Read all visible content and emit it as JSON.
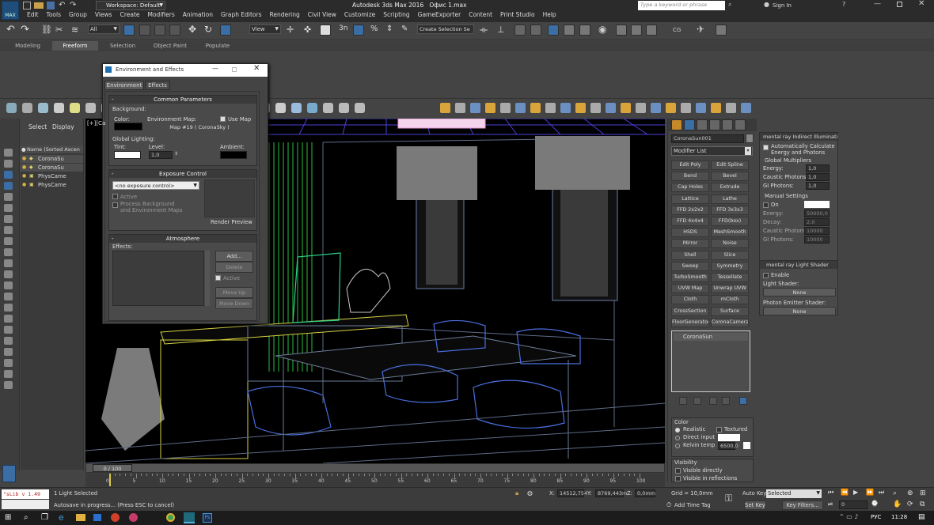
{
  "window": {
    "title": "Autodesk 3ds Max 2016",
    "file": "Офис 1.max",
    "workspace": "Workspace: Default",
    "search_placeholder": "Type a keyword or phrase",
    "sign_in": "Sign In",
    "logo": "MAX"
  },
  "menu": [
    "Edit",
    "Tools",
    "Group",
    "Views",
    "Create",
    "Modifiers",
    "Animation",
    "Graph Editors",
    "Rendering",
    "Civil View",
    "Customize",
    "Scripting",
    "GameExporter",
    "Content",
    "Print Studio",
    "Help"
  ],
  "toolbar": {
    "filter": "All",
    "refcoord": "View",
    "selection_set": "Create Selection Se",
    "snap_label": "3"
  },
  "ribbon_tabs": [
    "Modeling",
    "Freeform",
    "Selection",
    "Object Paint",
    "Populate"
  ],
  "scene_explorer": {
    "tabs": [
      "Select",
      "Display"
    ],
    "header": "Name (Sorted Ascen",
    "items": [
      "CoronaSu",
      "CoronaSu",
      "PhysCame",
      "PhysCame"
    ]
  },
  "viewport": {
    "label": "[+][Ca"
  },
  "dialog": {
    "title": "Environment and Effects",
    "tabs": [
      "Environment",
      "Effects"
    ],
    "common": {
      "header": "Common Parameters",
      "background": "Background:",
      "color": "Color:",
      "envmap": "Environment Map:",
      "use_map": "Use Map",
      "map_name": "Map #19  ( CoronaSky )",
      "global_lighting": "Global Lighting:",
      "tint": "Tint:",
      "level": "Level:",
      "level_value": "1,0",
      "ambient": "Ambient:"
    },
    "exposure": {
      "header": "Exposure Control",
      "select": "<no exposure control>",
      "active": "Active",
      "process": "Process Background",
      "process2": "and Environment Maps",
      "render_preview": "Render Preview"
    },
    "atmosphere": {
      "header": "Atmosphere",
      "effects": "Effects:",
      "add": "Add...",
      "delete": "Delete",
      "active": "Active",
      "move_up": "Move Up",
      "move_down": "Move Down"
    }
  },
  "command_panel": {
    "object_name": "CoronaSun001",
    "modifier_list": "Modifier List",
    "modifiers": [
      "Edit Poly",
      "Edit Spline",
      "Bend",
      "Bevel",
      "Cap Holes",
      "Extrude",
      "Lattice",
      "Lathe",
      "FFD 2x2x2",
      "FFD 3x3x3",
      "FFD 4x4x4",
      "FFD(box)",
      "HSDS",
      "MeshSmooth",
      "Mirror",
      "Noise",
      "Shell",
      "Slice",
      "Sweep",
      "Symmetry",
      "TurboSmooth",
      "Tessellate",
      "UVW Map",
      "Unwrap UVW",
      "Cloth",
      "mCloth",
      "CrossSection",
      "Surface",
      "FloorGenerator",
      "CoronaCameraM"
    ],
    "stack_item": "CoronaSun",
    "color_section": {
      "header": "Color",
      "realistic": "Realistic",
      "textured": "Textured",
      "direct_input": "Direct input",
      "kelvin": "Kelvin temp",
      "kelvin_value": "6500,0"
    },
    "visibility": {
      "header": "Visibility",
      "visible_directly": "Visible directly",
      "visible_reflections": "Visible in reflections"
    }
  },
  "right_panel": {
    "indirect": {
      "header": "mental ray Indirect Illumination",
      "auto_calc": "Automatically Calculate",
      "auto_calc2": "Energy and Photons",
      "global_mult": "Global Multipliers",
      "energy": "Energy:",
      "energy_val": "1,0",
      "caustic": "Caustic Photons:",
      "caustic_val": "1,0",
      "gi": "GI Photons:",
      "gi_val": "1,0",
      "manual": "Manual Settings",
      "on": "On",
      "m_energy": "Energy:",
      "m_energy_val": "50000,0",
      "decay": "Decay:",
      "decay_val": "2,0",
      "m_caustic": "Caustic Photons:",
      "m_caustic_val": "10000",
      "m_gi": "GI Photons:",
      "m_gi_val": "10000"
    },
    "shader": {
      "header": "mental ray Light Shader",
      "enable": "Enable",
      "light_shader": "Light Shader:",
      "none1": "None",
      "photon_shader": "Photon Emitter Shader:",
      "none2": "None"
    }
  },
  "timeline": {
    "frame": "0 / 100",
    "ticks": [
      "0",
      "5",
      "10",
      "15",
      "20",
      "25",
      "30",
      "35",
      "40",
      "45",
      "50",
      "55",
      "60",
      "65",
      "70",
      "75",
      "80",
      "85",
      "90",
      "95",
      "100"
    ]
  },
  "status": {
    "maxscript": "\"sLib v 1.49",
    "selected": "1 Light Selected",
    "autosave": "Autosave in progress... (Press ESC to cancel)",
    "x": "14512,754",
    "y": "8769,443m",
    "z": "0,0mm",
    "grid": "Grid = 10,0mm",
    "add_time_tag": "Add Time Tag",
    "auto_key": "Auto Key",
    "auto_key_value": "Selected",
    "set_key": "Set Key",
    "key_filters": "Key Filters...",
    "frame_field": "0"
  },
  "taskbar": {
    "lang": "РУС",
    "time": "11:28"
  },
  "colors": {
    "ui_bg": "#444444",
    "viewport_bg": "#000000",
    "accent_blue": "#3a6ea5"
  }
}
